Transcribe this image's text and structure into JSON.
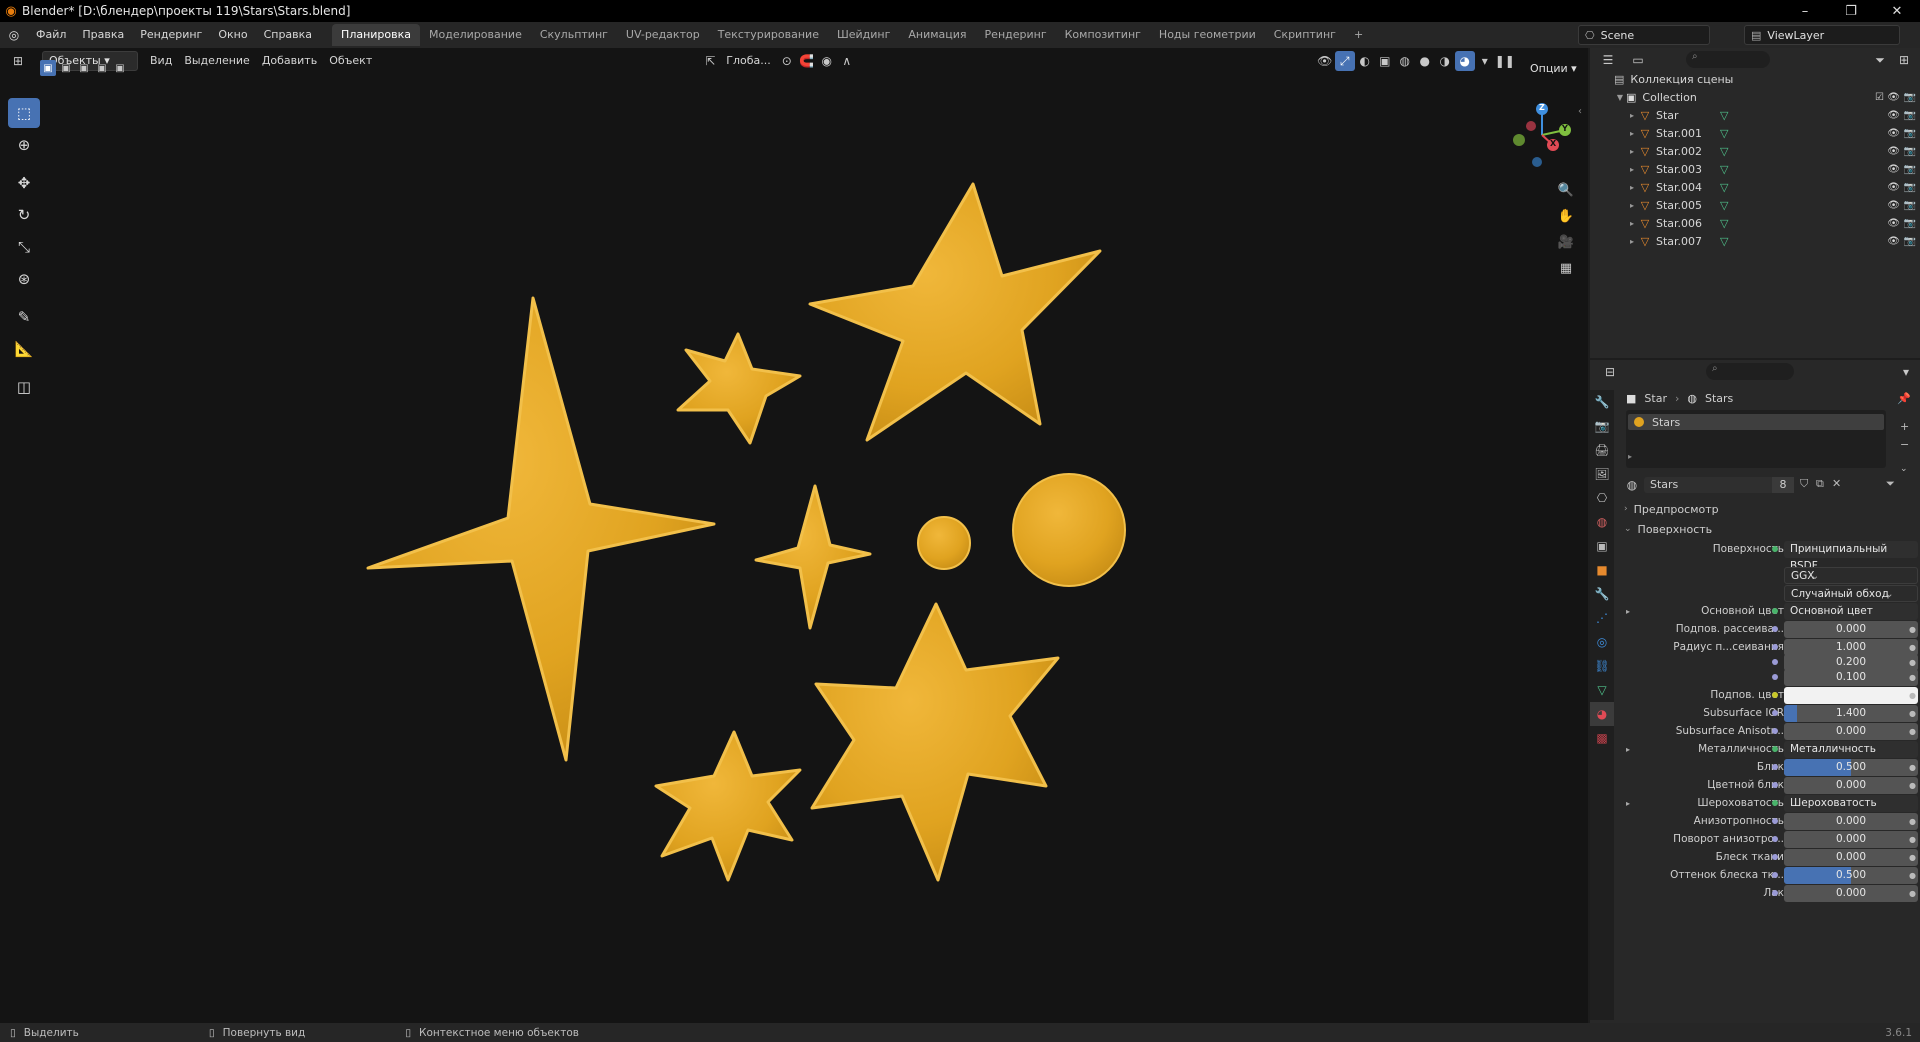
{
  "window": {
    "title": "Blender* [D:\\блендер\\проекты 119\\Stars\\Stars.blend]",
    "minimize": "–",
    "maximize": "❐",
    "close": "✕"
  },
  "menu": {
    "items": [
      "Файл",
      "Правка",
      "Рендеринг",
      "Окно",
      "Справка"
    ]
  },
  "workspaces": {
    "tabs": [
      "Планировка",
      "Моделирование",
      "Скульптинг",
      "UV-редактор",
      "Текстурирование",
      "Шейдинг",
      "Анимация",
      "Рендеринг",
      "Композитинг",
      "Ноды геометрии",
      "Скриптинг"
    ],
    "active": "Планировка",
    "add": "+"
  },
  "scene": {
    "name": "Scene",
    "view_layer": "ViewLayer"
  },
  "viewport": {
    "mode": "Объекты",
    "menus": [
      "Вид",
      "Выделение",
      "Добавить",
      "Объект"
    ],
    "transform_orientation": "Глоба...",
    "options": "Опции"
  },
  "gizmo": {
    "z": "Z",
    "y": "Y",
    "x": "X"
  },
  "outliner": {
    "scene_collection": "Коллекция сцены",
    "collection": "Collection",
    "objects": [
      "Star",
      "Star.001",
      "Star.002",
      "Star.003",
      "Star.004",
      "Star.005",
      "Star.006",
      "Star.007"
    ]
  },
  "properties": {
    "breadcrumb_object": "Star",
    "breadcrumb_material": "Stars",
    "material_slot": "Stars",
    "material_name": "Stars",
    "users": "8",
    "panels": {
      "preview": "Предпросмотр",
      "surface": "Поверхность"
    },
    "rows": [
      {
        "label": "Поверхность",
        "value": "Принципиальный BSDF",
        "kind": "link"
      },
      {
        "label": "",
        "value": "GGX",
        "kind": "select"
      },
      {
        "label": "",
        "value": "Случайный обход",
        "kind": "select"
      },
      {
        "label": "Основной цвет",
        "value": "Основной цвет",
        "kind": "link",
        "expand": true
      },
      {
        "label": "Подпов. рассеива...",
        "value": "0.000",
        "kind": "num"
      },
      {
        "label": "Радиус п...сеивания",
        "value": "1.000",
        "kind": "num"
      },
      {
        "label": "",
        "value": "0.200",
        "kind": "num"
      },
      {
        "label": "",
        "value": "0.100",
        "kind": "num"
      },
      {
        "label": "Подпов. цвет",
        "value": "",
        "kind": "color"
      },
      {
        "label": "Subsurface IOR",
        "value": "1.400",
        "kind": "num",
        "fill": 0.1
      },
      {
        "label": "Subsurface Anisotr...",
        "value": "0.000",
        "kind": "num"
      },
      {
        "label": "Металличность",
        "value": "Металличность",
        "kind": "link",
        "expand": true
      },
      {
        "label": "Блик",
        "value": "0.500",
        "kind": "num",
        "fill": 0.5
      },
      {
        "label": "Цветной блик",
        "value": "0.000",
        "kind": "num"
      },
      {
        "label": "Шероховатость",
        "value": "Шероховатость",
        "kind": "link",
        "expand": true
      },
      {
        "label": "Анизотропность",
        "value": "0.000",
        "kind": "num"
      },
      {
        "label": "Поворот анизотро...",
        "value": "0.000",
        "kind": "num"
      },
      {
        "label": "Блеск ткани",
        "value": "0.000",
        "kind": "num"
      },
      {
        "label": "Оттенок блеска тк...",
        "value": "0.500",
        "kind": "num",
        "fill": 0.5
      },
      {
        "label": "Лак",
        "value": "0.000",
        "kind": "num"
      }
    ]
  },
  "status": {
    "select": "Выделить",
    "rotate": "Повернуть вид",
    "context": "Контекстное меню объектов",
    "version": "3.6.1"
  },
  "colors": {
    "star": "#e0a320",
    "accent": "#4772b3",
    "viewport_bg": "#141414"
  }
}
